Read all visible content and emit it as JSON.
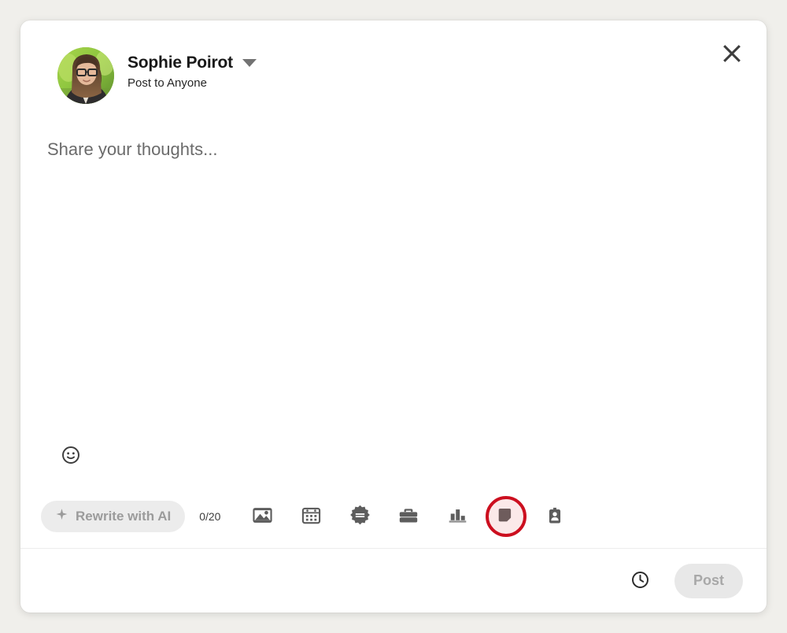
{
  "window": {
    "background_color": "#f0efeb",
    "card_background": "#ffffff"
  },
  "header": {
    "close_label": "Close",
    "close_icon": "close-icon",
    "avatar_alt": "Sophie Poirot profile photo",
    "display_name": "Sophie Poirot",
    "audience": "Post to Anyone",
    "caret_icon": "chevron-down-icon"
  },
  "composer": {
    "placeholder": "Share your thoughts...",
    "value": "",
    "emoji_icon": "smiley-icon",
    "emoji_label": "Open emoji keyboard"
  },
  "toolbar": {
    "ai_button": {
      "label": "Rewrite with AI",
      "icon": "sparkle-icon",
      "enabled": false,
      "background_color": "#ececec",
      "text_color": "#9b9b9b"
    },
    "counter": "0/20",
    "items": [
      {
        "name": "add-media-button",
        "icon": "image-icon",
        "label": "Add media"
      },
      {
        "name": "add-event-button",
        "icon": "calendar-icon",
        "label": "Create an event"
      },
      {
        "name": "celebrate-button",
        "icon": "award-badge-icon",
        "label": "Celebrate an occasion"
      },
      {
        "name": "job-button",
        "icon": "briefcase-icon",
        "label": "Share that you're hiring"
      },
      {
        "name": "poll-button",
        "icon": "poll-bars-icon",
        "label": "Create a poll"
      },
      {
        "name": "document-button",
        "icon": "document-icon",
        "label": "Add a document"
      },
      {
        "name": "id-badge-button",
        "icon": "id-badge-icon",
        "label": "Find an expert"
      }
    ],
    "highlight": {
      "target": "document-button",
      "ring_color": "#cc0f1f",
      "fill_color": "#fbe9e9",
      "glyph_color": "#6e5c5c"
    }
  },
  "footer": {
    "schedule_icon": "clock-icon",
    "schedule_label": "Schedule post",
    "post_label": "Post",
    "post_enabled": false,
    "post_background": "#e8e8e8",
    "post_text_color": "#a8a8a8"
  }
}
